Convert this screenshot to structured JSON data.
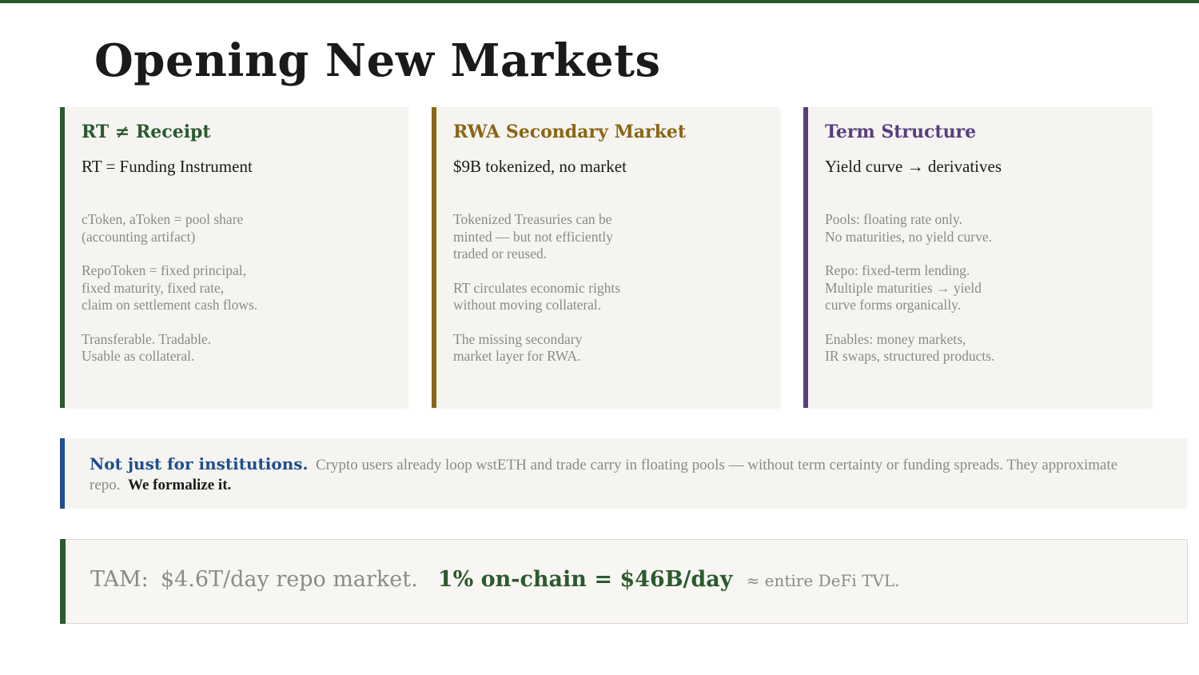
{
  "title": "Opening New Markets",
  "cards": [
    {
      "heading": "RT ≠ Receipt",
      "subheading": "RT = Funding Instrument",
      "paragraphs": [
        "cToken, aToken = pool share\n(accounting artifact)",
        "RepoToken = fixed principal,\nfixed maturity, fixed rate,\nclaim on settlement cash flows.",
        "Transferable. Tradable.\nUsable as collateral."
      ],
      "accent": "#2b5a2e"
    },
    {
      "heading": "RWA Secondary Market",
      "subheading": "$9B tokenized, no market",
      "paragraphs": [
        "Tokenized Treasuries can be\nminted — but not efficiently\ntraded or reused.",
        "RT circulates economic rights\nwithout moving collateral.",
        "The missing secondary\nmarket layer for RWA."
      ],
      "accent": "#8a6514"
    },
    {
      "heading": "Term Structure",
      "subheading": "Yield curve → derivatives",
      "paragraphs": [
        "Pools: floating rate only.\nNo maturities, no yield curve.",
        "Repo: fixed-term lending.\nMultiple maturities → yield\ncurve forms organically.",
        "Enables: money markets,\nIR swaps, structured products."
      ],
      "accent": "#5b3e7e"
    }
  ],
  "callout": {
    "lead": "Not just for institutions.",
    "body": "Crypto users already loop wstETH and trade carry in floating pools — without term certainty or funding spreads.  They approximate repo.",
    "closing": "We formalize it.",
    "accent": "#1f4e8c"
  },
  "tam": {
    "label": "TAM:",
    "market": "$4.6T/day repo market.",
    "highlight": "1% on-chain = $46B/day",
    "comparison": "≈ entire DeFi TVL.",
    "accent": "#2b5a2e"
  }
}
